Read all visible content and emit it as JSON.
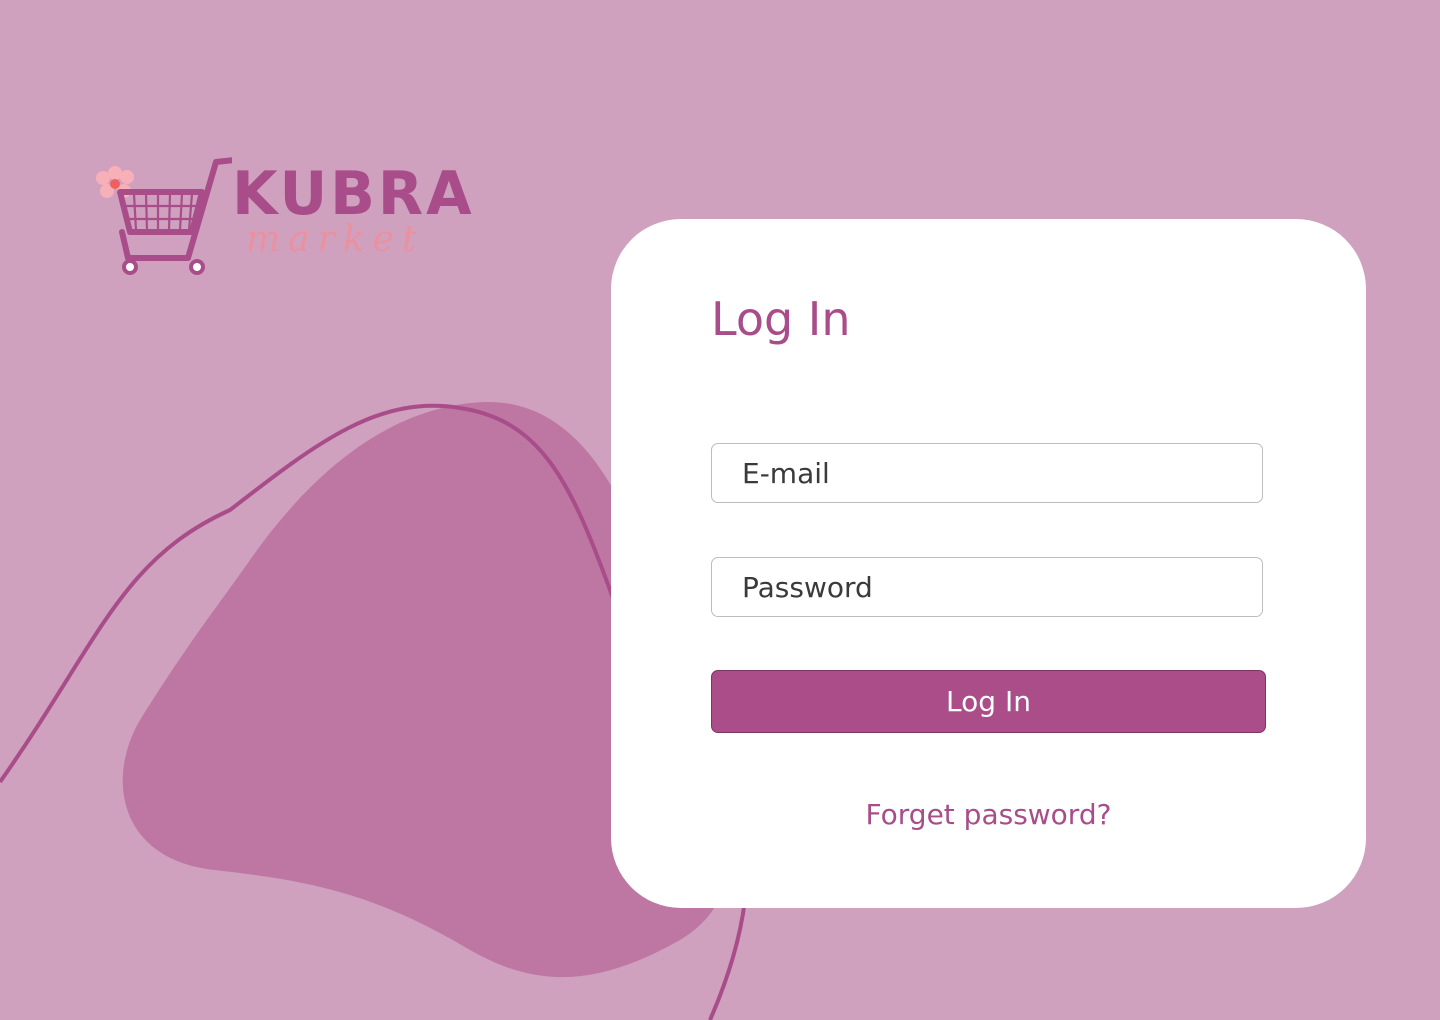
{
  "brand": {
    "name": "KUBRA",
    "subtitle": "market",
    "logo_icon": "shopping-cart-with-flower-icon"
  },
  "login_card": {
    "title": "Log In",
    "email_placeholder": "E-mail",
    "password_placeholder": "Password",
    "submit_label": "Log In",
    "forgot_label": "Forget password?"
  },
  "colors": {
    "background": "#cfa1be",
    "blob": "#be77a2",
    "accent": "#a94d8a",
    "card": "#ffffff",
    "logo_script": "#f08e9a"
  }
}
